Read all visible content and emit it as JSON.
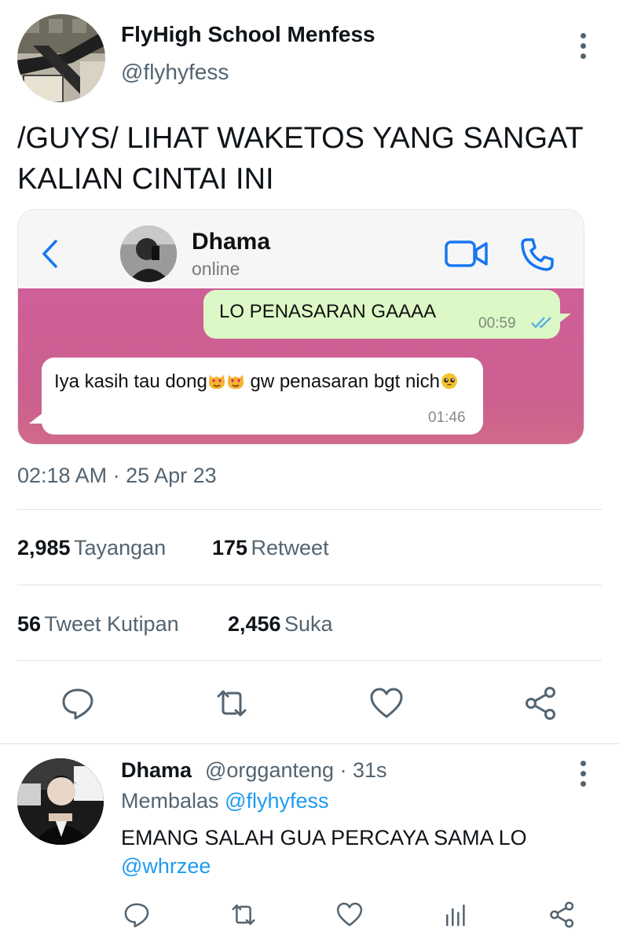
{
  "tweet": {
    "author_name": "FlyHigh School Menfess",
    "author_handle": "@flyhyfess",
    "text": "/GUYS/ LIHAT WAKETOS YANG SANGAT KALIAN CINTAI INI",
    "timestamp": "02:18 AM · 25 Apr 23",
    "stats": {
      "views_count": "2,985",
      "views_label": "Tayangan",
      "retweets_count": "175",
      "retweets_label": "Retweet",
      "quotes_count": "56",
      "quotes_label": "Tweet Kutipan",
      "likes_count": "2,456",
      "likes_label": "Suka"
    }
  },
  "media": {
    "contact_name": "Dhama",
    "contact_status": "online",
    "outgoing_message": "LO PENASARAN GAAAA",
    "outgoing_time": "00:59",
    "incoming_message_part1": "Iya kasih tau dong",
    "incoming_message_part2": " gw penasaran bgt nich",
    "incoming_time": "01:46",
    "colors": {
      "chat_background": "#cf5f98",
      "outgoing_bubble": "#dcf8c6",
      "ios_blue": "#1877f2"
    }
  },
  "reply": {
    "author_name": "Dhama",
    "meta": "@orgganteng · 31s",
    "replying_label": "Membalas",
    "replying_to": "@flyhyfess",
    "text": "EMANG SALAH GUA PERCAYA SAMA LO",
    "mention": "@whrzee"
  },
  "icons": [
    "more-vertical-icon",
    "reply-icon",
    "retweet-icon",
    "like-icon",
    "share-icon",
    "analytics-icon",
    "back-chevron-icon",
    "video-call-icon",
    "phone-icon",
    "double-check-icon"
  ],
  "colors": {
    "link": "#1d9bf0",
    "secondary_text": "#536471",
    "divider": "#dfe3e6"
  }
}
